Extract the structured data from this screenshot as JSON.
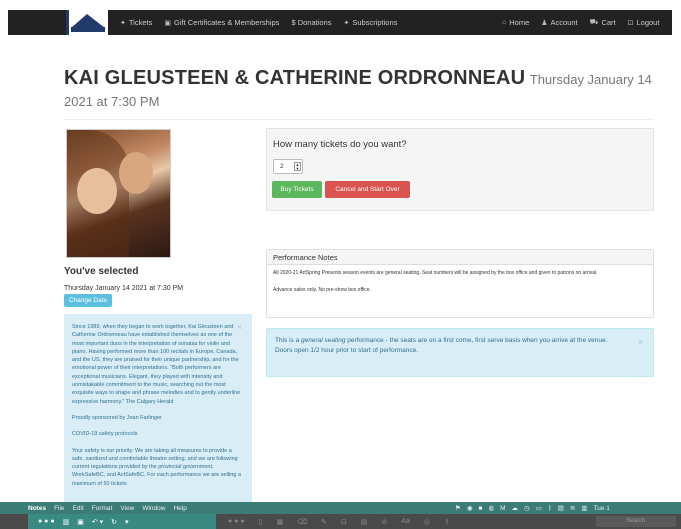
{
  "nav": {
    "left": [
      {
        "icon": "tag-icon",
        "glyph": "✦",
        "label": "Tickets"
      },
      {
        "icon": "gift-icon",
        "glyph": "▣",
        "label": "Gift Certificates & Memberships"
      },
      {
        "icon": "dollar-icon",
        "glyph": "",
        "label": "$ Donations"
      },
      {
        "icon": "tag-icon",
        "glyph": "✦",
        "label": "Subscriptions"
      }
    ],
    "right": [
      {
        "icon": "home-icon",
        "glyph": "⌂",
        "label": "Home"
      },
      {
        "icon": "user-icon",
        "glyph": "♟",
        "label": "Account"
      },
      {
        "icon": "cart-icon",
        "glyph": "⛟",
        "label": "Cart"
      },
      {
        "icon": "lock-icon",
        "glyph": "⊡",
        "label": "Logout"
      }
    ]
  },
  "event": {
    "title": "KAI GLEUSTEEN & CATHERINE ORDRONNEAU",
    "datetime": "Thursday January 14 2021 at 7:30 PM"
  },
  "selection": {
    "heading": "You've selected",
    "date": "Thursday January 14 2021 at 7:30 PM",
    "change_label": "Change Date"
  },
  "info": {
    "paragraphs": [
      "Since 1989, when they began to work together, Kai Gleusteen and Catherine Ordronneau have established themselves as one of the most important duos in the interpretation of sonatas for violin and piano. Having performed more than 100 recitals in Europe, Canada, and the US, they are praised for their unique partnership, and for the emotional power of their interpretations. \"Both performers are exceptional musicians. Elegant, they played with intensity and unmistakable commitment to the music, searching out the most exquisite ways to shape and phrase melodies and to gently underline expressive harmony.\" The Calgary Herald",
      "Proudly sponsored by Joan Farlinger",
      "COVID-19 safety protocols",
      "Your safety is our priority. We are taking all measures to provide a safe, sanitized and comfortable theatre setting, and we are following current regulations provided by the provincial government, WorkSafeBC, and ActSafeBC. For each performance we are selling a maximum of 50 tickets"
    ],
    "close": "×"
  },
  "tickets": {
    "question": "How many tickets do you want?",
    "quantity": "2",
    "buy_label": "Buy Tickets",
    "cancel_label": "Cancel and Start Over"
  },
  "performance_notes": {
    "heading": "Performance Notes",
    "lines": [
      "All 2020-21 ArtSpring Presents season events are general seating. Seat numbers will be assigned by the box office and given to patrons on arrival.",
      "Advance sales only. No pre-show box office."
    ]
  },
  "seating_alert": {
    "line1_prefix": "This is a ",
    "line1_em": "general seating",
    "line1_suffix": " performance - the seats are on a first come, first serve basis when you arrive at the venue.",
    "line2": "Doors open 1/2 hour prior to start of performance.",
    "close": "×"
  },
  "macos": {
    "menu": [
      "Notes",
      "File",
      "Edit",
      "Format",
      "View",
      "Window",
      "Help"
    ],
    "clock": "Tue 1",
    "search_placeholder": "Search"
  }
}
